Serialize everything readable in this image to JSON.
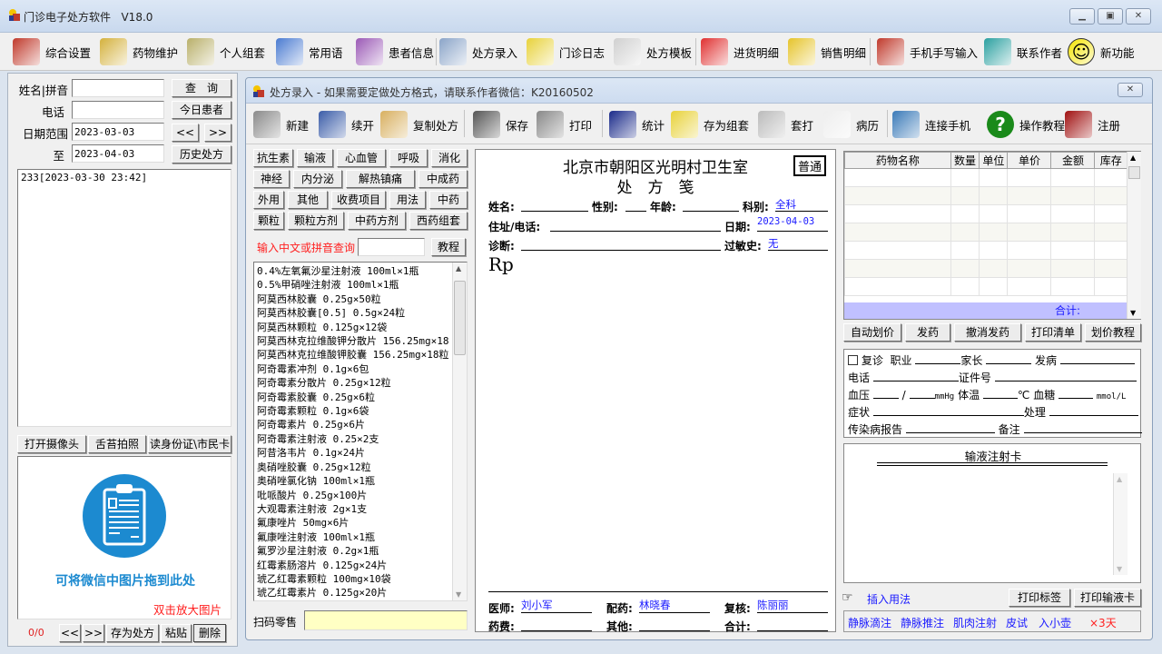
{
  "window": {
    "title": "门诊电子处方软件",
    "version": "V18.0",
    "min": "▭",
    "max": "□",
    "close": "✕"
  },
  "toolbar": [
    {
      "label": "综合设置",
      "icon": "settings-disc-icon",
      "color": "#c0392b"
    },
    {
      "label": "药物维护",
      "icon": "drug-maintenance-icon",
      "color": "#d4b13c"
    },
    {
      "label": "个人组套",
      "icon": "personal-set-icon",
      "color": "#b9b06a"
    },
    {
      "label": "常用语",
      "icon": "common-phrases-icon",
      "color": "#4a7bd1"
    },
    {
      "label": "患者信息",
      "icon": "patient-info-icon",
      "color": "#9b59b6"
    },
    {
      "label": "处方录入",
      "icon": "prescription-entry-icon",
      "color": "#8aa4c8"
    },
    {
      "label": "门诊日志",
      "icon": "clinic-log-icon",
      "color": "#e8d23a"
    },
    {
      "label": "处方模板",
      "icon": "template-icon",
      "color": "#d0d0d0"
    },
    {
      "label": "进货明细",
      "icon": "purchase-chart-icon",
      "color": "#e03030"
    },
    {
      "label": "销售明细",
      "icon": "sales-icon",
      "color": "#e6c42a"
    },
    {
      "label": "手机手写输入",
      "icon": "handwriting-icon",
      "color": "#c0392b"
    },
    {
      "label": "联系作者",
      "icon": "contact-pin-icon",
      "color": "#2aa0a0"
    },
    {
      "label": "新功能",
      "icon": "smiley-icon",
      "color": "#f5e400"
    }
  ],
  "search": {
    "name_label": "姓名|拼音",
    "name_value": "",
    "phone_label": "电话",
    "phone_value": "",
    "date_label": "日期范围",
    "date_from": "2023-03-03",
    "to_label": "至",
    "date_to": "2023-04-03",
    "query_btn": "查　询",
    "today_btn": "今日患者",
    "prev_btn": "<<",
    "next_btn": ">>",
    "history_btn": "历史处方"
  },
  "records": [
    "233[2023-03-30 23:42]"
  ],
  "photo": {
    "camera_btn": "打开摄像头",
    "tongue_btn": "舌苔拍照",
    "idcard_btn": "读身份证\\市民卡",
    "drop_hint": "可将微信中图片拖到此处",
    "zoom_hint": "双击放大图片",
    "counter": "0/0",
    "prev": "<<",
    "next": ">>",
    "save_rx": "存为处方",
    "paste": "粘贴",
    "delete": "删除"
  },
  "rx_window": {
    "title": "处方录入 - 如果需要定做处方格式，请联系作者微信：K20160502",
    "close": "✕",
    "toolbar": [
      {
        "label": "新建",
        "icon": "new-icon"
      },
      {
        "label": "续开",
        "icon": "continue-icon"
      },
      {
        "label": "复制处方",
        "icon": "copy-folder-icon"
      },
      {
        "label": "保存",
        "icon": "save-floppy-icon"
      },
      {
        "label": "打印",
        "icon": "printer-icon"
      },
      {
        "label": "统计",
        "icon": "statistics-icon"
      },
      {
        "label": "存为组套",
        "icon": "save-set-icon"
      },
      {
        "label": "套打",
        "icon": "template-print-icon"
      },
      {
        "label": "病历",
        "icon": "medical-record-icon"
      },
      {
        "label": "连接手机",
        "icon": "connect-phone-icon"
      },
      {
        "label": "操作教程",
        "icon": "help-icon"
      },
      {
        "label": "注册",
        "icon": "register-icon"
      }
    ]
  },
  "categories": [
    [
      "抗生素",
      "输液",
      "心血管",
      "呼吸",
      "消化"
    ],
    [
      "神经",
      "内分泌",
      "解热镇痛",
      "中成药"
    ],
    [
      "外用",
      "其他",
      "收费项目",
      "用法",
      "中药"
    ],
    [
      "颗粒",
      "颗粒方剂",
      "中药方剂",
      "西药组套"
    ]
  ],
  "drug_search": {
    "label": "输入中文或拼音查询",
    "value": "",
    "tutorial_btn": "教程"
  },
  "drugs": [
    "0.4%左氧氟沙星注射液 100ml×1瓶",
    "0.5%甲硝唑注射液 100ml×1瓶",
    "阿莫西林胶囊 0.25g×50粒",
    "阿莫西林胶囊[0.5] 0.5g×24粒",
    "阿莫西林颗粒 0.125g×12袋",
    "阿莫西林克拉维酸钾分散片 156.25mg×18",
    "阿莫西林克拉维酸钾胶囊 156.25mg×18粒",
    "阿奇霉素冲剂 0.1g×6包",
    "阿奇霉素分散片 0.25g×12粒",
    "阿奇霉素胶囊 0.25g×6粒",
    "阿奇霉素颗粒 0.1g×6袋",
    "阿奇霉素片 0.25g×6片",
    "阿奇霉素注射液 0.25×2支",
    "阿昔洛韦片 0.1g×24片",
    "奥硝唑胶囊 0.25g×12粒",
    "奥硝唑氯化钠 100ml×1瓶",
    "吡哌酸片 0.25g×100片",
    "大观霉素注射液 2g×1支",
    "氟康唑片 50mg×6片",
    "氟康唑注射液 100ml×1瓶",
    "氟罗沙星注射液 0.2g×1瓶",
    "红霉素肠溶片 0.125g×24片",
    "琥乙红霉素颗粒 100mg×10袋",
    "琥乙红霉素片 0.125g×20片"
  ],
  "scan": {
    "label": "扫码零售",
    "value": ""
  },
  "prescription": {
    "clinic": "北京市朝阳区光明村卫生室",
    "title": "处　方　笺",
    "type_badge": "普通",
    "name_label": "姓名:",
    "name": "",
    "sex_label": "性别:",
    "sex": "",
    "age_label": "年龄:",
    "age": "",
    "dept_label": "科别:",
    "dept": "全科",
    "addr_label": "住址/电话:",
    "addr": "",
    "date_label": "日期:",
    "date": "2023-04-03",
    "diag_label": "诊断:",
    "diag": "",
    "allergy_label": "过敏史:",
    "allergy": "无",
    "rp": "Rp",
    "doctor_label": "医师:",
    "doctor": "刘小军",
    "dispense_label": "配药:",
    "dispenser": "林晓春",
    "review_label": "复核:",
    "reviewer": "陈丽丽",
    "fee_label": "药费:",
    "fee": "",
    "other_label": "其他:",
    "other": "",
    "total_label": "合计:",
    "total": ""
  },
  "med_grid": {
    "columns": [
      "药物名称",
      "数量",
      "单位",
      "单价",
      "金额",
      "库存"
    ],
    "rows": [],
    "total_label": "合计:"
  },
  "grid_buttons": [
    "自动划价",
    "发药",
    "撤消发药",
    "打印清单",
    "划价教程"
  ],
  "vitals": {
    "revisit": "复诊",
    "job": "职业",
    "parent": "家长",
    "onset": "发病",
    "phone": "电话",
    "idno": "证件号",
    "bp": "血压",
    "bp_sep": "/",
    "bp_unit": "mmHg",
    "temp": "体温",
    "temp_unit": "℃",
    "glucose": "血糖",
    "glucose_unit": "mmol/L",
    "symptom": "症状",
    "treatment": "处理",
    "infectious": "传染病报告",
    "remark": "备注"
  },
  "infusion": {
    "title": "输液注射卡",
    "insert_usage": "插入用法",
    "print_label": "打印标签",
    "print_card": "打印输液卡"
  },
  "usages": [
    {
      "label": "静脉滴注",
      "color": "#1a1aff"
    },
    {
      "label": "静脉推注",
      "color": "#1a1aff"
    },
    {
      "label": "肌肉注射",
      "color": "#1a1aff"
    },
    {
      "label": "皮试",
      "color": "#1a1aff"
    },
    {
      "label": "入小壶",
      "color": "#1a1aff"
    },
    {
      "label": "×3天",
      "color": "#ff2020"
    }
  ]
}
